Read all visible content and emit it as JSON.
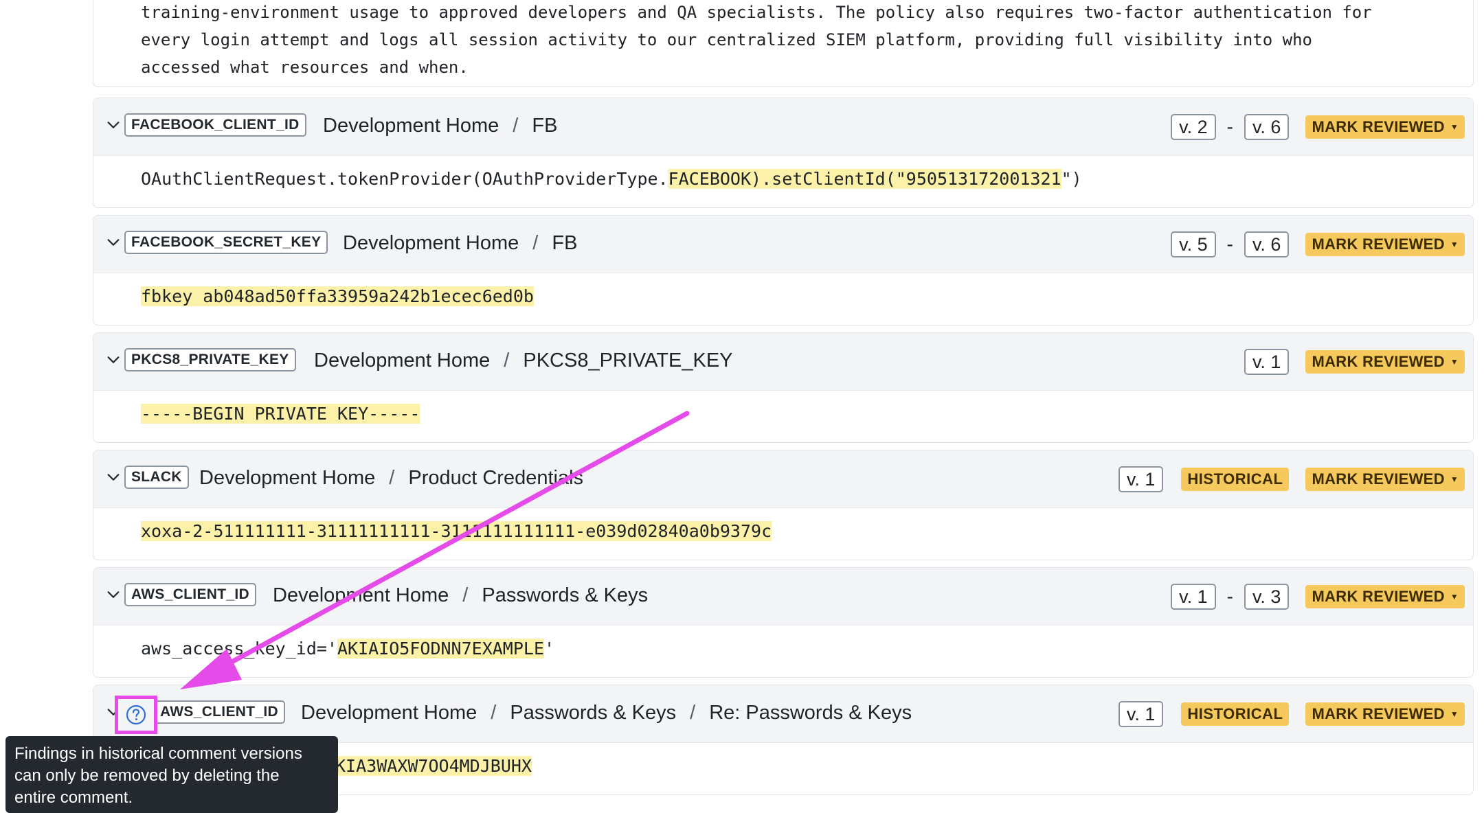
{
  "policy_description": {
    "lines": [
      "training-environment usage to approved developers and QA specialists. The policy also requires two-factor authentication for",
      "every login attempt and logs all session activity to our centralized SIEM platform, providing full visibility into who",
      "accessed what resources and when."
    ]
  },
  "findings": [
    {
      "type": "FACEBOOK_CLIENT_ID",
      "path": [
        "Development Home",
        "FB"
      ],
      "version_from": "v. 2",
      "version_to": "v. 6",
      "historical": "",
      "review_label": "MARK REVIEWED",
      "match_pre": "OAuthClientRequest.tokenProvider(OAuthProviderType.",
      "match": "FACEBOOK).setClientId(\"950513172001321",
      "match_post": "\")"
    },
    {
      "type": "FACEBOOK_SECRET_KEY",
      "path": [
        "Development Home",
        "FB"
      ],
      "version_from": "v. 5",
      "version_to": "v. 6",
      "historical": "",
      "review_label": "MARK REVIEWED",
      "match_pre": "",
      "match": "fbkey ab048ad50ffa33959a242b1ecec6ed0b",
      "match_post": ""
    },
    {
      "type": "PKCS8_PRIVATE_KEY",
      "path": [
        "Development Home",
        "PKCS8_PRIVATE_KEY"
      ],
      "version_from": "v. 1",
      "version_to": "",
      "historical": "",
      "review_label": "MARK REVIEWED",
      "match_pre": "",
      "match": "-----BEGIN PRIVATE KEY-----",
      "match_post": ""
    },
    {
      "type": "SLACK",
      "path": [
        "Development Home",
        "Product Credentials"
      ],
      "version_from": "v. 1",
      "version_to": "",
      "historical": "HISTORICAL",
      "review_label": "MARK REVIEWED",
      "match_pre": "",
      "match": "xoxa-2-511111111-31111111111-3111111111111-e039d02840a0b9379c",
      "match_post": ""
    },
    {
      "type": "AWS_CLIENT_ID",
      "path": [
        "Development Home",
        "Passwords & Keys"
      ],
      "version_from": "v. 1",
      "version_to": "v. 3",
      "historical": "",
      "review_label": "MARK REVIEWED",
      "match_pre": "aws_access_key_id='",
      "match": "AKIAIO5FODNN7EXAMPLE",
      "match_post": "'"
    },
    {
      "type": "AWS_CLIENT_ID",
      "path": [
        "Development Home",
        "Passwords & Keys",
        "Re: Passwords & Keys"
      ],
      "version_from": "v. 1",
      "version_to": "",
      "historical": "HISTORICAL",
      "review_label": "MARK REVIEWED",
      "match_pre": "",
      "match": "KIA3WAXW7OO4MDJBUHX",
      "match_post": ""
    }
  ],
  "tooltip": {
    "lines": [
      "Findings in historical comment versions",
      "can only be removed by deleting the",
      "entire comment."
    ]
  },
  "icons": {
    "expand": "chevron-down-icon",
    "help": "question-circle-icon",
    "annotation": "arrow-annotation"
  },
  "colors": {
    "highlight": "#fbf1a9",
    "badge": "#f5c95b",
    "annotation": "#e54be8",
    "tooltip_bg": "#24292f"
  }
}
